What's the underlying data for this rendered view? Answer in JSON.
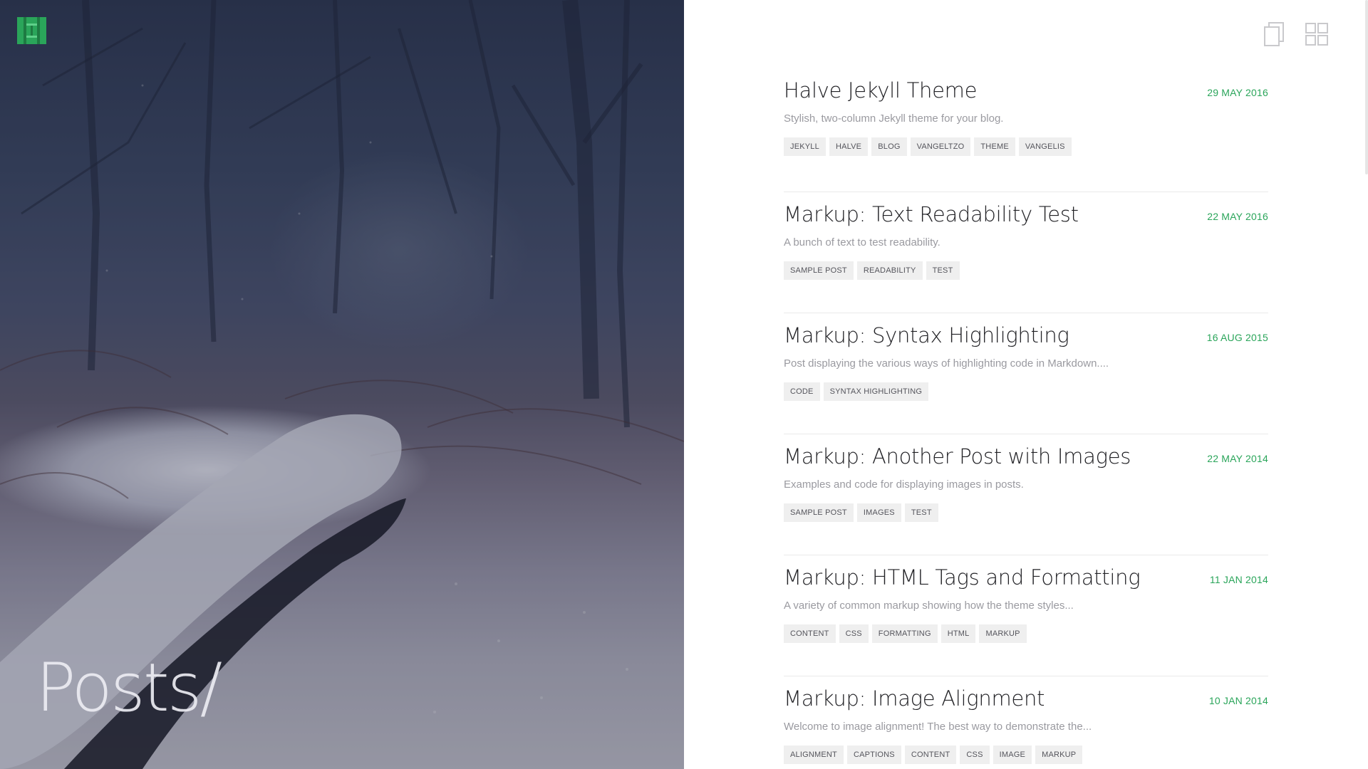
{
  "hero": {
    "title": "Posts/",
    "logo_color": "#2aa55a"
  },
  "view_toggles": [
    {
      "name": "list-view",
      "icon": "stacked-pages-icon"
    },
    {
      "name": "grid-view",
      "icon": "grid-icon"
    }
  ],
  "accent_color": "#2aa55a",
  "posts": [
    {
      "title": "Halve Jekyll Theme",
      "date": "29 MAY 2016",
      "excerpt": "Stylish, two-column Jekyll theme for your blog.",
      "tags": [
        "JEKYLL",
        "HALVE",
        "BLOG",
        "VANGELTZO",
        "THEME",
        "VANGELIS"
      ]
    },
    {
      "title": "Markup: Text Readability Test",
      "date": "22 MAY 2016",
      "excerpt": "A bunch of text to test readability.",
      "tags": [
        "SAMPLE POST",
        "READABILITY",
        "TEST"
      ]
    },
    {
      "title": "Markup: Syntax Highlighting",
      "date": "16 AUG 2015",
      "excerpt": "Post displaying the various ways of highlighting code in Markdown....",
      "tags": [
        "CODE",
        "SYNTAX HIGHLIGHTING"
      ]
    },
    {
      "title": "Markup: Another Post with Images",
      "date": "22 MAY 2014",
      "excerpt": "Examples and code for displaying images in posts.",
      "tags": [
        "SAMPLE POST",
        "IMAGES",
        "TEST"
      ]
    },
    {
      "title": "Markup: HTML Tags and Formatting",
      "date": "11 JAN 2014",
      "excerpt": "A variety of common markup showing how the theme styles...",
      "tags": [
        "CONTENT",
        "CSS",
        "FORMATTING",
        "HTML",
        "MARKUP"
      ]
    },
    {
      "title": "Markup: Image Alignment",
      "date": "10 JAN 2014",
      "excerpt": "Welcome to image alignment! The best way to demonstrate the...",
      "tags": [
        "ALIGNMENT",
        "CAPTIONS",
        "CONTENT",
        "CSS",
        "IMAGE",
        "MARKUP"
      ]
    }
  ]
}
